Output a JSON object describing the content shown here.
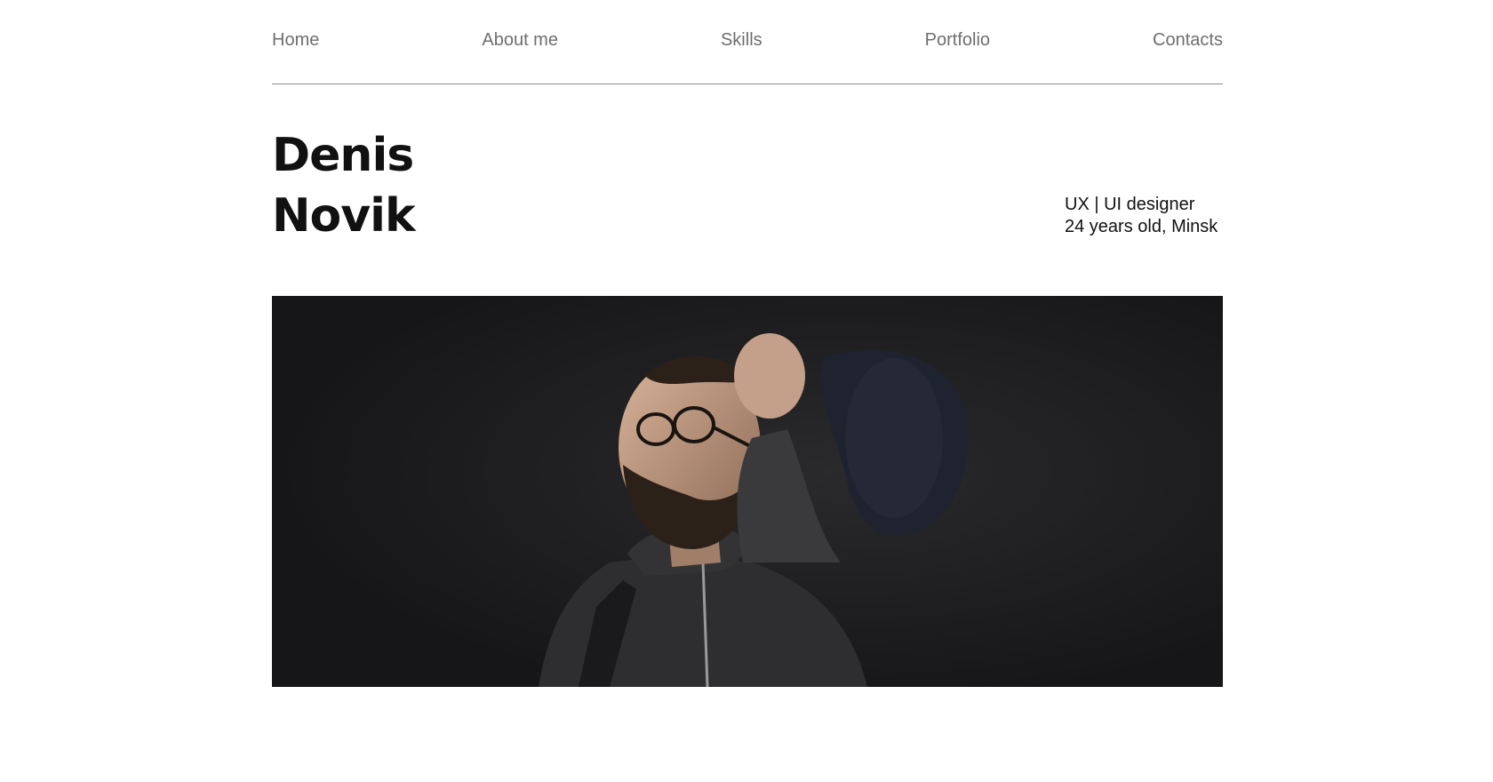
{
  "nav": {
    "items": [
      {
        "label": "Home"
      },
      {
        "label": "About me"
      },
      {
        "label": "Skills"
      },
      {
        "label": "Portfolio"
      },
      {
        "label": "Contacts"
      }
    ]
  },
  "hero": {
    "first_name": "Denis",
    "last_name": "Novik",
    "role": "UX | UI designer",
    "details": "24 years old, Minsk"
  },
  "photo": {
    "subject": "portrait-photo",
    "colors": {
      "background": "#1b1b1d",
      "hoodie": "#2e2e30",
      "skin": "#b8917a",
      "cap": "#1f2330"
    }
  }
}
